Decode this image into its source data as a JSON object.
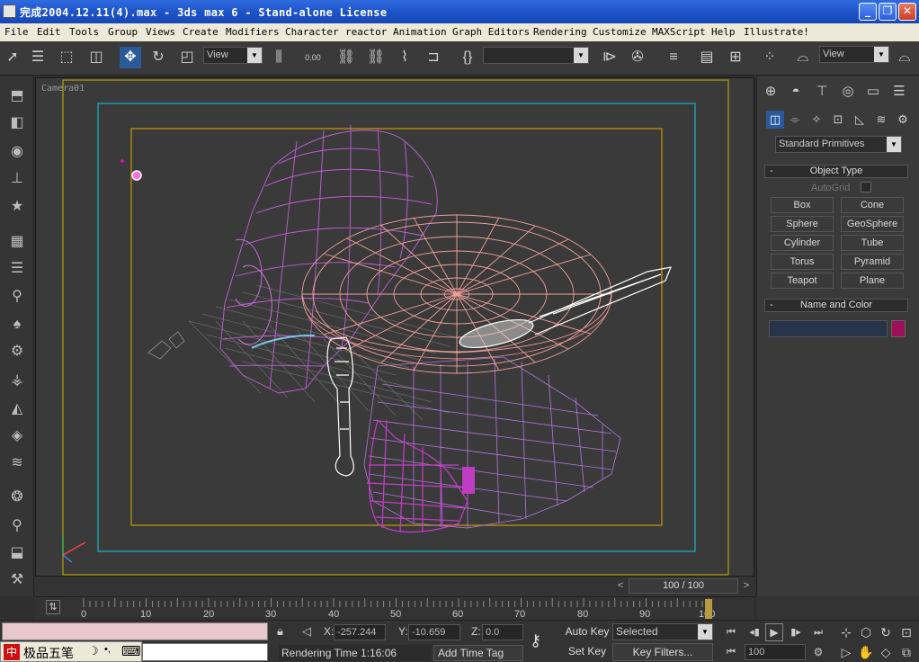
{
  "window": {
    "title": "完成2004.12.11(4).max - 3ds max 6 - Stand-alone License",
    "minimize": "_",
    "restore": "❐",
    "close": "✕"
  },
  "menu": [
    "File",
    "Edit",
    "Tools",
    "Group",
    "Views",
    "Create",
    "Modifiers",
    "Character",
    "reactor",
    "Animation",
    "Graph Editors",
    "Rendering",
    "Customize",
    "MAXScript",
    "Help",
    "Illustrate!"
  ],
  "toolbar": {
    "ref_coord": "View",
    "spinner_value": "0.00",
    "named_selection": "",
    "render_view": "View"
  },
  "viewport": {
    "label": "Camera01"
  },
  "command_panel": {
    "category": "Standard Primitives",
    "object_type_title": "Object Type",
    "autogrid": "AutoGrid",
    "buttons": [
      "Box",
      "Cone",
      "Sphere",
      "GeoSphere",
      "Cylinder",
      "Tube",
      "Torus",
      "Pyramid",
      "Teapot",
      "Plane"
    ],
    "name_color_title": "Name and Color",
    "object_name": "",
    "object_color": "#a0105a"
  },
  "time": {
    "frame_display": "100 / 100",
    "ticks": [
      "0",
      "10",
      "20",
      "30",
      "40",
      "50",
      "60",
      "70",
      "80",
      "90",
      "100"
    ],
    "current_frame": 100
  },
  "status": {
    "x_label": "X:",
    "x_value": "-257.244",
    "y_label": "Y:",
    "y_value": "-10.659",
    "z_label": "Z:",
    "z_value": "0.0",
    "rendering_time": "Rendering Time  1:16:06",
    "add_time_tag": "Add Time Tag",
    "auto_key": "Auto Key",
    "set_key": "Set Key",
    "selected": "Selected",
    "key_filters": "Key Filters...",
    "frame_field": "100"
  },
  "ime": {
    "logo": "中",
    "name": "极品五笔",
    "moon": "☽",
    "dots": "•,",
    "keyboard": "⌨"
  }
}
